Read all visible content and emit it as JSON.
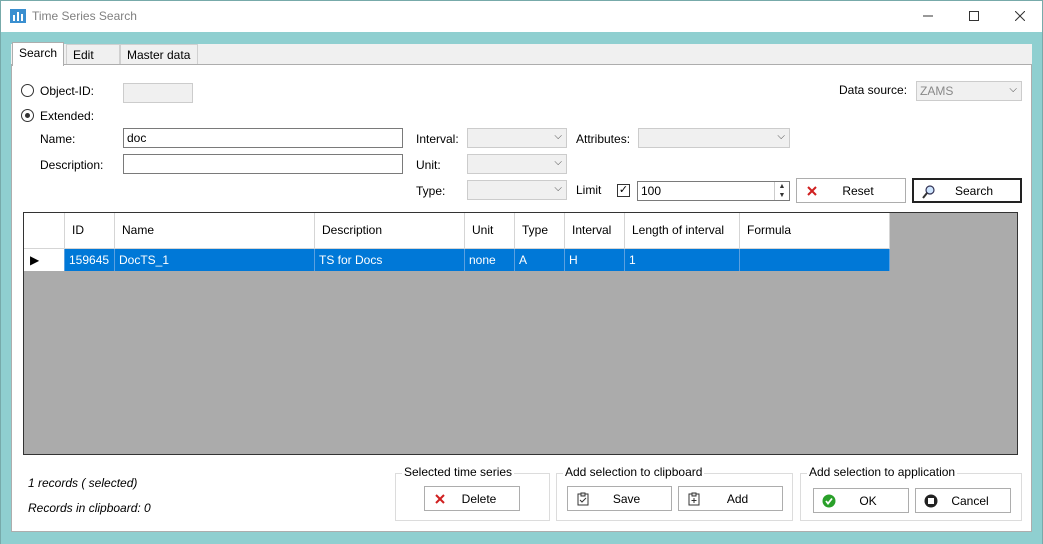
{
  "window": {
    "title": "Time Series Search"
  },
  "tabs": [
    {
      "label": "Search"
    },
    {
      "label": "Edit"
    },
    {
      "label": "Master data"
    }
  ],
  "search": {
    "object_id_label": "Object-ID:",
    "object_id_value": "",
    "extended_label": "Extended:",
    "data_source_label": "Data source:",
    "data_source_value": "ZAMS",
    "name_label": "Name:",
    "name_value": "doc",
    "description_label": "Description:",
    "description_value": "",
    "interval_label": "Interval:",
    "interval_value": "",
    "attributes_label": "Attributes:",
    "attributes_value": "",
    "unit_label": "Unit:",
    "unit_value": "",
    "type_label": "Type:",
    "type_value": "",
    "limit_label": "Limit",
    "limit_checked": true,
    "limit_value": "100",
    "reset_label": "Reset",
    "search_label": "Search"
  },
  "grid": {
    "columns": [
      "ID",
      "Name",
      "Description",
      "Unit",
      "Type",
      "Interval",
      "Length of interval",
      "Formula"
    ],
    "rows": [
      {
        "id": "159645",
        "name": "DocTS_1",
        "description": "TS for Docs",
        "unit": "none",
        "type": "A",
        "interval": "H",
        "length": "1",
        "formula": ""
      }
    ]
  },
  "status": {
    "records": "1 records ( selected)",
    "clipboard": "Records in clipboard: 0"
  },
  "groups": {
    "selected_title": "Selected time series",
    "delete_label": "Delete",
    "clipboard_title": "Add selection to clipboard",
    "save_label": "Save",
    "add_label": "Add",
    "application_title": "Add selection to application",
    "ok_label": "OK",
    "cancel_label": "Cancel"
  },
  "colors": {
    "selection": "#0078d7",
    "background": "#8fcfd0"
  }
}
